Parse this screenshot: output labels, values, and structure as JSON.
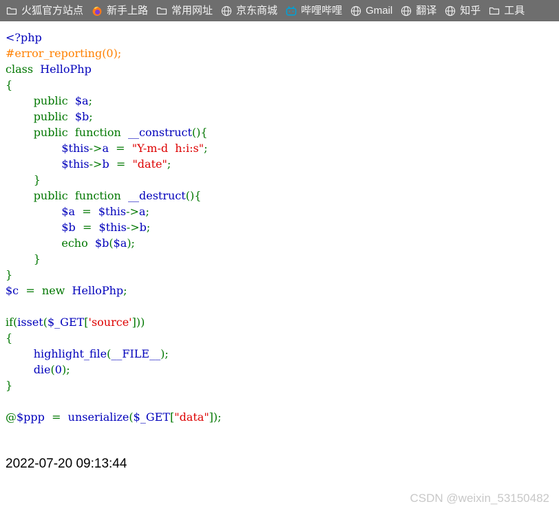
{
  "browser": {
    "bookmarks_bar": {
      "background": "#6e6e6e",
      "items": [
        {
          "label": "火狐官方站点",
          "icon": "folder-icon"
        },
        {
          "label": "新手上路",
          "icon": "firefox-icon"
        },
        {
          "label": "常用网址",
          "icon": "folder-icon"
        },
        {
          "label": "京东商城",
          "icon": "globe-icon"
        },
        {
          "label": "哔哩哔哩",
          "icon": "bilibili-icon"
        },
        {
          "label": "Gmail",
          "icon": "globe-icon"
        },
        {
          "label": "翻译",
          "icon": "globe-icon"
        },
        {
          "label": "知乎",
          "icon": "globe-icon"
        },
        {
          "label": "工具",
          "icon": "folder-icon"
        }
      ]
    }
  },
  "page": {
    "colors": {
      "default": "#0000BB",
      "keyword": "#007700",
      "string": "#DD0000",
      "comment": "#FF8000",
      "background": "#FFFFFF"
    },
    "source_lines": [
      [
        {
          "t": "<?php",
          "c": "default"
        }
      ],
      [
        {
          "t": "#error_reporting(0);",
          "c": "comment"
        }
      ],
      [
        {
          "t": "class",
          "c": "keyword"
        },
        {
          "t": "  ",
          "c": "keyword"
        },
        {
          "t": "HelloPhp",
          "c": "default"
        }
      ],
      [
        {
          "t": "{",
          "c": "keyword"
        }
      ],
      [
        {
          "t": "        ",
          "c": "keyword"
        },
        {
          "t": "public",
          "c": "keyword"
        },
        {
          "t": "  ",
          "c": "keyword"
        },
        {
          "t": "$a",
          "c": "default"
        },
        {
          "t": ";",
          "c": "keyword"
        }
      ],
      [
        {
          "t": "        ",
          "c": "keyword"
        },
        {
          "t": "public",
          "c": "keyword"
        },
        {
          "t": "  ",
          "c": "keyword"
        },
        {
          "t": "$b",
          "c": "default"
        },
        {
          "t": ";",
          "c": "keyword"
        }
      ],
      [
        {
          "t": "        ",
          "c": "keyword"
        },
        {
          "t": "public",
          "c": "keyword"
        },
        {
          "t": "  ",
          "c": "keyword"
        },
        {
          "t": "function",
          "c": "keyword"
        },
        {
          "t": "  ",
          "c": "keyword"
        },
        {
          "t": "__construct",
          "c": "default"
        },
        {
          "t": "(){",
          "c": "keyword"
        }
      ],
      [
        {
          "t": "                ",
          "c": "keyword"
        },
        {
          "t": "$this",
          "c": "default"
        },
        {
          "t": "->",
          "c": "keyword"
        },
        {
          "t": "a",
          "c": "default"
        },
        {
          "t": "  =  ",
          "c": "keyword"
        },
        {
          "t": "\"Y-m-d  h:i:s\"",
          "c": "string"
        },
        {
          "t": ";",
          "c": "keyword"
        }
      ],
      [
        {
          "t": "                ",
          "c": "keyword"
        },
        {
          "t": "$this",
          "c": "default"
        },
        {
          "t": "->",
          "c": "keyword"
        },
        {
          "t": "b",
          "c": "default"
        },
        {
          "t": "  =  ",
          "c": "keyword"
        },
        {
          "t": "\"date\"",
          "c": "string"
        },
        {
          "t": ";",
          "c": "keyword"
        }
      ],
      [
        {
          "t": "        ",
          "c": "keyword"
        },
        {
          "t": "}",
          "c": "keyword"
        }
      ],
      [
        {
          "t": "        ",
          "c": "keyword"
        },
        {
          "t": "public",
          "c": "keyword"
        },
        {
          "t": "  ",
          "c": "keyword"
        },
        {
          "t": "function",
          "c": "keyword"
        },
        {
          "t": "  ",
          "c": "keyword"
        },
        {
          "t": "__destruct",
          "c": "default"
        },
        {
          "t": "(){",
          "c": "keyword"
        }
      ],
      [
        {
          "t": "                ",
          "c": "keyword"
        },
        {
          "t": "$a",
          "c": "default"
        },
        {
          "t": "  =  ",
          "c": "keyword"
        },
        {
          "t": "$this",
          "c": "default"
        },
        {
          "t": "->",
          "c": "keyword"
        },
        {
          "t": "a",
          "c": "default"
        },
        {
          "t": ";",
          "c": "keyword"
        }
      ],
      [
        {
          "t": "                ",
          "c": "keyword"
        },
        {
          "t": "$b",
          "c": "default"
        },
        {
          "t": "  =  ",
          "c": "keyword"
        },
        {
          "t": "$this",
          "c": "default"
        },
        {
          "t": "->",
          "c": "keyword"
        },
        {
          "t": "b",
          "c": "default"
        },
        {
          "t": ";",
          "c": "keyword"
        }
      ],
      [
        {
          "t": "                ",
          "c": "keyword"
        },
        {
          "t": "echo",
          "c": "keyword"
        },
        {
          "t": "  ",
          "c": "keyword"
        },
        {
          "t": "$b",
          "c": "default"
        },
        {
          "t": "(",
          "c": "keyword"
        },
        {
          "t": "$a",
          "c": "default"
        },
        {
          "t": ");",
          "c": "keyword"
        }
      ],
      [
        {
          "t": "        ",
          "c": "keyword"
        },
        {
          "t": "}",
          "c": "keyword"
        }
      ],
      [
        {
          "t": "}",
          "c": "keyword"
        }
      ],
      [
        {
          "t": "$c",
          "c": "default"
        },
        {
          "t": "  =  ",
          "c": "keyword"
        },
        {
          "t": "new",
          "c": "keyword"
        },
        {
          "t": "  ",
          "c": "keyword"
        },
        {
          "t": "HelloPhp",
          "c": "default"
        },
        {
          "t": ";",
          "c": "keyword"
        }
      ],
      [
        {
          "t": " ",
          "c": "keyword"
        }
      ],
      [
        {
          "t": "if",
          "c": "keyword"
        },
        {
          "t": "(",
          "c": "keyword"
        },
        {
          "t": "isset",
          "c": "default"
        },
        {
          "t": "(",
          "c": "keyword"
        },
        {
          "t": "$_GET",
          "c": "default"
        },
        {
          "t": "[",
          "c": "keyword"
        },
        {
          "t": "'source'",
          "c": "string"
        },
        {
          "t": "]))",
          "c": "keyword"
        }
      ],
      [
        {
          "t": "{",
          "c": "keyword"
        }
      ],
      [
        {
          "t": "        ",
          "c": "keyword"
        },
        {
          "t": "highlight_file",
          "c": "default"
        },
        {
          "t": "(",
          "c": "keyword"
        },
        {
          "t": "__FILE__",
          "c": "default"
        },
        {
          "t": ");",
          "c": "keyword"
        }
      ],
      [
        {
          "t": "        ",
          "c": "keyword"
        },
        {
          "t": "die",
          "c": "default"
        },
        {
          "t": "(",
          "c": "keyword"
        },
        {
          "t": "0",
          "c": "default"
        },
        {
          "t": ");",
          "c": "keyword"
        }
      ],
      [
        {
          "t": "}",
          "c": "keyword"
        }
      ],
      [
        {
          "t": " ",
          "c": "keyword"
        }
      ],
      [
        {
          "t": "@",
          "c": "keyword"
        },
        {
          "t": "$ppp",
          "c": "default"
        },
        {
          "t": "  =  ",
          "c": "keyword"
        },
        {
          "t": "unserialize",
          "c": "default"
        },
        {
          "t": "(",
          "c": "keyword"
        },
        {
          "t": "$_GET",
          "c": "default"
        },
        {
          "t": "[",
          "c": "keyword"
        },
        {
          "t": "\"data\"",
          "c": "string"
        },
        {
          "t": "]);",
          "c": "keyword"
        }
      ]
    ],
    "echo_output": "2022-07-20 09:13:44",
    "watermark": "CSDN @weixin_53150482"
  }
}
